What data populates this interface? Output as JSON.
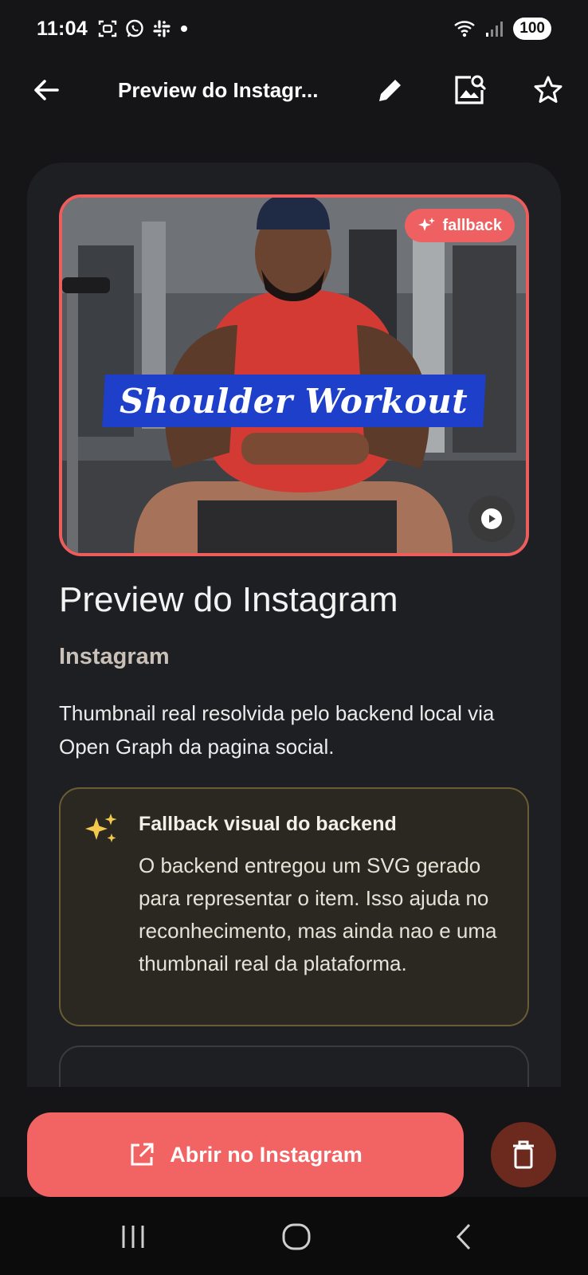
{
  "status_bar": {
    "time": "11:04",
    "battery": "100"
  },
  "app_bar": {
    "title": "Preview do Instagr..."
  },
  "media": {
    "chip_label": "fallback",
    "overlay_text": "Shoulder Workout"
  },
  "content": {
    "title": "Preview do Instagram",
    "subtitle": "Instagram",
    "description": "Thumbnail real resolvida pelo backend local via Open Graph da pagina social."
  },
  "notice": {
    "title": "Fallback visual do backend",
    "body": "O backend entregou um SVG gerado para representar o item. Isso ajuda no reconhecimento, mas ainda nao e uma thumbnail real da plataforma."
  },
  "actions": {
    "open_label": "Abrir no Instagram"
  },
  "colors": {
    "accent": "#f26464",
    "background": "#151517",
    "card": "#1e1f22",
    "notice_bg": "#2a2820",
    "notice_border": "#6b5c36",
    "delete_bg": "#6c2a1e",
    "sparkle": "#f2c94c"
  },
  "icons": {
    "back": "arrow-left-icon",
    "edit": "pencil-icon",
    "image_search": "image-search-icon",
    "favorite": "star-outline-icon",
    "sparkle": "sparkle-icon",
    "play": "play-icon",
    "open_external": "open-external-icon",
    "delete": "trash-icon"
  }
}
